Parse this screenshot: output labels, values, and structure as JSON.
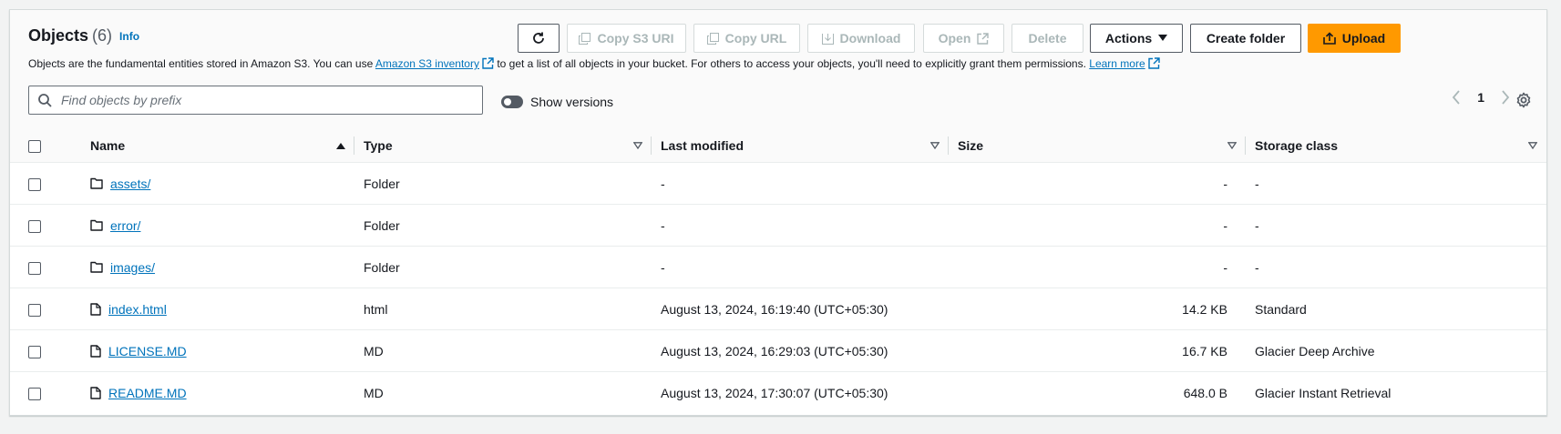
{
  "header": {
    "title": "Objects",
    "count": "(6)",
    "info_link": "Info",
    "description_prefix": "Objects are the fundamental entities stored in Amazon S3. You can use",
    "inventory_link": "Amazon S3 inventory",
    "description_middle": "to get a list of all objects in your bucket. For others to access your objects, you'll need to explicitly grant them permissions.",
    "learn_more": "Learn more"
  },
  "toolbar": {
    "copy_s3_uri": "Copy S3 URI",
    "copy_url": "Copy URL",
    "download": "Download",
    "open": "Open",
    "delete": "Delete",
    "actions": "Actions",
    "create_folder": "Create folder",
    "upload": "Upload"
  },
  "search": {
    "placeholder": "Find objects by prefix"
  },
  "versions_toggle": {
    "label": "Show versions",
    "enabled": false
  },
  "pagination": {
    "current_page": "1"
  },
  "table": {
    "columns": [
      "Name",
      "Type",
      "Last modified",
      "Size",
      "Storage class"
    ],
    "rows": [
      {
        "name": "assets/",
        "kind": "folder",
        "type": "Folder",
        "modified": "-",
        "size": "-",
        "storage": "-"
      },
      {
        "name": "error/",
        "kind": "folder",
        "type": "Folder",
        "modified": "-",
        "size": "-",
        "storage": "-"
      },
      {
        "name": "images/",
        "kind": "folder",
        "type": "Folder",
        "modified": "-",
        "size": "-",
        "storage": "-"
      },
      {
        "name": "index.html",
        "kind": "file",
        "type": "html",
        "modified": "August 13, 2024, 16:19:40 (UTC+05:30)",
        "size": "14.2 KB",
        "storage": "Standard"
      },
      {
        "name": "LICENSE.MD",
        "kind": "file",
        "type": "MD",
        "modified": "August 13, 2024, 16:29:03 (UTC+05:30)",
        "size": "16.7 KB",
        "storage": "Glacier Deep Archive"
      },
      {
        "name": "README.MD",
        "kind": "file",
        "type": "MD",
        "modified": "August 13, 2024, 17:30:07 (UTC+05:30)",
        "size": "648.0 B",
        "storage": "Glacier Instant Retrieval"
      }
    ]
  },
  "colors": {
    "link": "#0073bb",
    "primary": "#ff9900",
    "disabled": "#aab7b8"
  }
}
